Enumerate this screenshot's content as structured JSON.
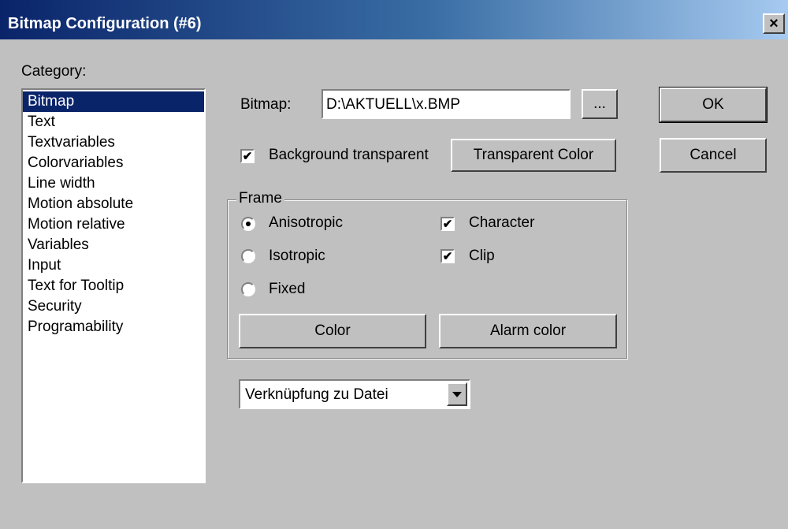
{
  "window": {
    "title": "Bitmap Configuration (#6)",
    "close_glyph": "×"
  },
  "category": {
    "label": "Category:",
    "items": [
      "Bitmap",
      "Text",
      "Textvariables",
      "Colorvariables",
      "Line width",
      "Motion absolute",
      "Motion relative",
      "Variables",
      "Input",
      "Text for Tooltip",
      "Security",
      "Programability"
    ],
    "selected": "Bitmap"
  },
  "bitmap": {
    "label": "Bitmap:",
    "path": "D:\\AKTUELL\\x.BMP",
    "browse_label": "..."
  },
  "background": {
    "transparent_label": "Background transparent",
    "transparent_checked": true,
    "color_button": "Transparent Color"
  },
  "frame": {
    "label": "Frame",
    "radios": [
      {
        "label": "Anisotropic",
        "checked": true
      },
      {
        "label": "Isotropic",
        "checked": false
      },
      {
        "label": "Fixed",
        "checked": false
      }
    ],
    "checks": [
      {
        "label": "Character",
        "checked": true
      },
      {
        "label": "Clip",
        "checked": true
      }
    ],
    "color_button": "Color",
    "alarm_color_button": "Alarm color"
  },
  "link": {
    "selected": "Verknüpfung zu Datei"
  },
  "buttons": {
    "ok": "OK",
    "cancel": "Cancel"
  },
  "glyphs": {
    "check": "✔"
  }
}
